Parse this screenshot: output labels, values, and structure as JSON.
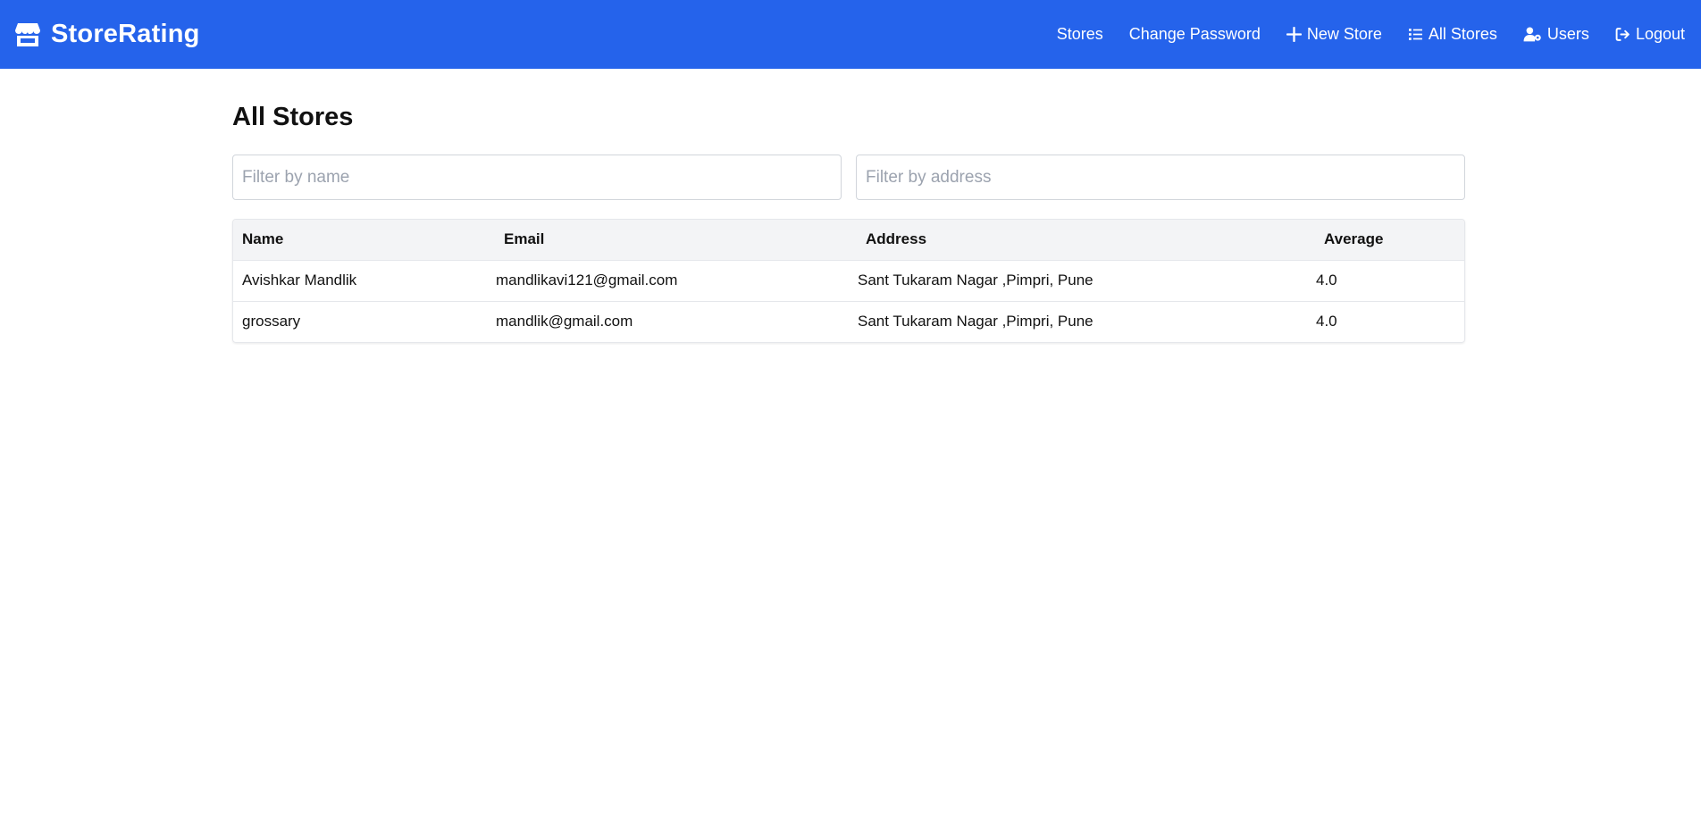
{
  "brand": {
    "name": "StoreRating",
    "icon": "store-icon"
  },
  "nav": {
    "items": [
      {
        "label": "Stores",
        "icon": ""
      },
      {
        "label": "Change Password",
        "icon": ""
      },
      {
        "label": "New Store",
        "icon": "plus-icon"
      },
      {
        "label": "All Stores",
        "icon": "list-icon"
      },
      {
        "label": "Users",
        "icon": "user-gear-icon"
      },
      {
        "label": "Logout",
        "icon": "logout-icon"
      }
    ]
  },
  "page": {
    "title": "All Stores"
  },
  "filters": {
    "name_placeholder": "Filter by name",
    "name_value": "",
    "address_placeholder": "Filter by address",
    "address_value": ""
  },
  "table": {
    "headers": [
      "Name",
      "Email",
      "Address",
      "Average"
    ],
    "rows": [
      [
        "Avishkar Mandlik",
        "mandlikavi121@gmail.com",
        "Sant Tukaram Nagar ,Pimpri, Pune",
        "4.0"
      ],
      [
        "grossary",
        "mandlik@gmail.com",
        "Sant Tukaram Nagar ,Pimpri, Pune",
        "4.0"
      ]
    ]
  },
  "colors": {
    "navbar": "#2563eb",
    "header_row": "#f3f4f6"
  }
}
